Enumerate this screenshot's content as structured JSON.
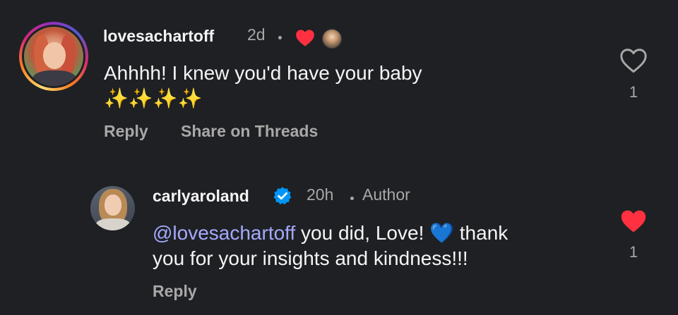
{
  "comments": [
    {
      "username": "lovesachartoff",
      "time": "2d",
      "text_line1": "Ahhhh! I knew you'd have your baby",
      "text_line2": "✨✨✨✨",
      "reply_label": "Reply",
      "share_label": "Share on Threads",
      "like_count": "1",
      "liked": false
    },
    {
      "username": "carlyaroland",
      "time": "20h",
      "author_badge": "Author",
      "mention": "@lovesachartoff",
      "text_after_mention": " you did, Love! 💙 thank",
      "text_line2": "you for your insights and kindness!!!",
      "reply_label": "Reply",
      "like_count": "1",
      "liked": true
    }
  ],
  "colors": {
    "background": "#1f2023",
    "primary_text": "#f5f5f5",
    "secondary_text": "#a8a8a8",
    "like_red": "#ff3040",
    "mention": "#a4a9ff",
    "verified_blue": "#0095f6"
  }
}
